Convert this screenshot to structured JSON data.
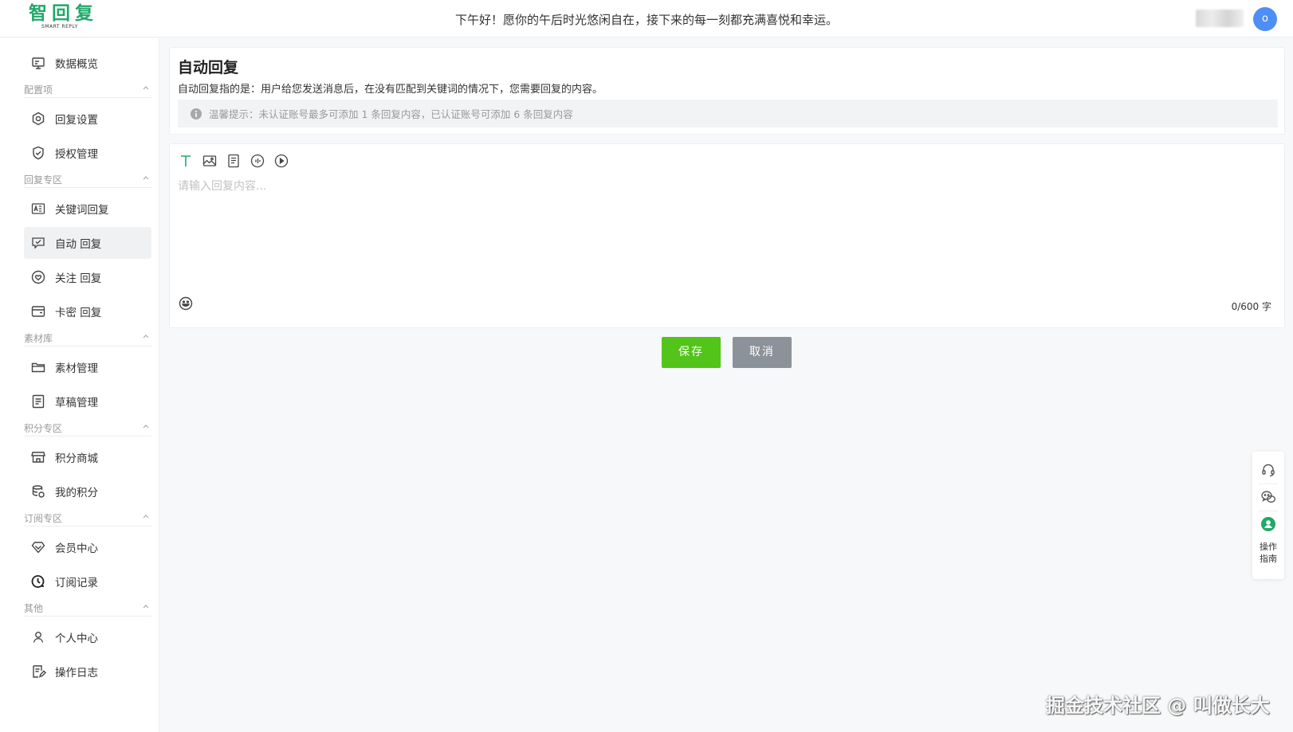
{
  "header": {
    "logo_text": "智回复",
    "logo_subtext": "SMART REPLY",
    "greeting": "下午好！愿你的午后时光悠闲自在，接下来的每一刻都充满喜悦和幸运。",
    "avatar_initial": "o"
  },
  "sidebar": {
    "overview": {
      "label": "数据概览",
      "icon": "monitor-icon"
    },
    "sections": [
      {
        "title": "配置项",
        "items": [
          {
            "label": "回复设置",
            "icon": "gear-icon"
          },
          {
            "label": "授权管理",
            "icon": "shield-check-icon"
          }
        ]
      },
      {
        "title": "回复专区",
        "items": [
          {
            "label": "关键词回复",
            "icon": "keyword-icon"
          },
          {
            "label": "自动 回复",
            "icon": "auto-reply-icon",
            "active": true
          },
          {
            "label": "关注 回复",
            "icon": "heart-icon"
          },
          {
            "label": "卡密 回复",
            "icon": "card-icon"
          }
        ]
      },
      {
        "title": "素材库",
        "items": [
          {
            "label": "素材管理",
            "icon": "folder-icon"
          },
          {
            "label": "草稿管理",
            "icon": "draft-icon"
          }
        ]
      },
      {
        "title": "积分专区",
        "items": [
          {
            "label": "积分商城",
            "icon": "store-icon"
          },
          {
            "label": "我的积分",
            "icon": "coins-icon"
          }
        ]
      },
      {
        "title": "订阅专区",
        "items": [
          {
            "label": "会员中心",
            "icon": "diamond-icon"
          },
          {
            "label": "订阅记录",
            "icon": "clock-icon"
          }
        ]
      },
      {
        "title": "其他",
        "items": [
          {
            "label": "个人中心",
            "icon": "user-icon"
          },
          {
            "label": "操作日志",
            "icon": "log-icon"
          }
        ]
      }
    ]
  },
  "main": {
    "title": "自动回复",
    "description": "自动回复指的是：用户给您发送消息后，在没有匹配到关键词的情况下，您需要回复的内容。",
    "tip": "温馨提示：未认证账号最多可添加 1 条回复内容，已认证账号可添加 6 条回复内容",
    "editor": {
      "toolbar": [
        "text-icon",
        "image-icon",
        "article-icon",
        "audio-icon",
        "video-icon"
      ],
      "placeholder": "请输入回复内容...",
      "value": "",
      "counter": "0/600 字"
    },
    "save_label": "保存",
    "cancel_label": "取消"
  },
  "float_panel": {
    "items": [
      "headset-icon",
      "wechat-icon",
      "user-circle-icon"
    ],
    "guide_label_line1": "操作",
    "guide_label_line2": "指南"
  },
  "watermark": "掘金技术社区 @ 叫做长大",
  "colors": {
    "brand": "#22a86a",
    "save": "#52c41a",
    "cancel": "#8c9299",
    "avatar": "#4e8ef7"
  }
}
